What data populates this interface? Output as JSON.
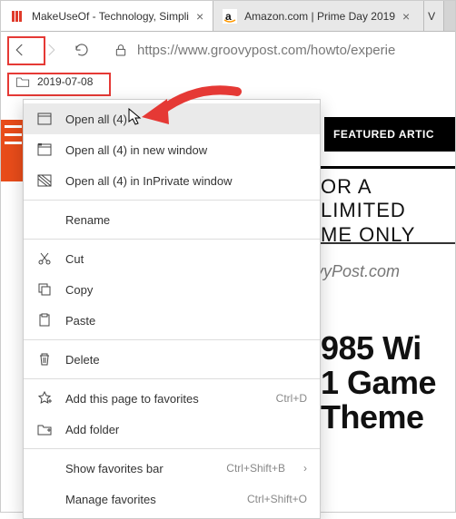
{
  "tabs": [
    {
      "title": "MakeUseOf - Technology, Simpli"
    },
    {
      "title": "Amazon.com | Prime Day 2019"
    },
    {
      "title": "V"
    }
  ],
  "nav": {
    "url": "https://www.groovypost.com/howto/experie"
  },
  "bookmarks_bar": {
    "folder_label": "2019-07-08"
  },
  "menu": {
    "open_all": "Open all (4)",
    "open_all_new": "Open all (4) in new window",
    "open_all_priv": "Open all (4) in InPrivate window",
    "rename": "Rename",
    "cut": "Cut",
    "copy": "Copy",
    "paste": "Paste",
    "delete": "Delete",
    "add_page": "Add this page to favorites",
    "add_page_kbd": "Ctrl+D",
    "add_folder": "Add folder",
    "show_bar": "Show favorites bar",
    "show_bar_kbd": "Ctrl+Shift+B",
    "manage": "Manage favorites",
    "manage_kbd": "Ctrl+Shift+O"
  },
  "page": {
    "nav_item": "FEATURED ARTIC",
    "promo_l1": "OR A LIMITED",
    "promo_l2": "ME ONLY",
    "watermark": "groovyPost.com",
    "headline_l1": "985 Wi",
    "headline_l2": "1 Game",
    "headline_l3": "Theme"
  }
}
